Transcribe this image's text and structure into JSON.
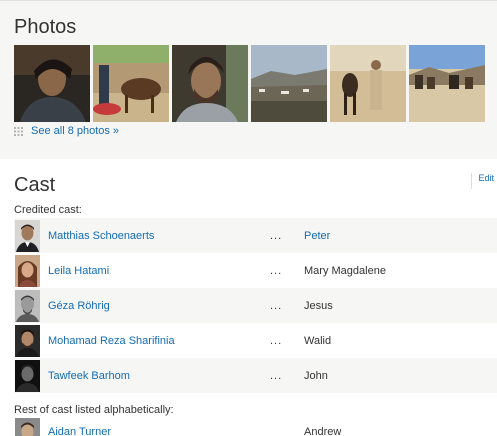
{
  "photos": {
    "title": "Photos",
    "see_all_label": "See all 8 photos",
    "see_all_arrow": "»",
    "thumbnails": [
      {
        "name": "photo-thumbnail-1",
        "palette": [
          "#3a2a1d",
          "#7d5c40",
          "#1c1a18"
        ]
      },
      {
        "name": "photo-thumbnail-2",
        "palette": [
          "#b9a27e",
          "#6a4a2b",
          "#c03a3a"
        ]
      },
      {
        "name": "photo-thumbnail-3",
        "palette": [
          "#5c4a3a",
          "#8a6d52",
          "#2a2420"
        ]
      },
      {
        "name": "photo-thumbnail-4",
        "palette": [
          "#9fb0c4",
          "#6e6a5a",
          "#3f3d36"
        ]
      },
      {
        "name": "photo-thumbnail-5",
        "palette": [
          "#cbb38c",
          "#4a3a2c",
          "#e6dcc6"
        ]
      },
      {
        "name": "photo-thumbnail-6",
        "palette": [
          "#7ea6d6",
          "#6b5a4a",
          "#d8c8a8"
        ]
      }
    ]
  },
  "cast": {
    "title": "Cast",
    "edit_label": "Edit",
    "credited_label": "Credited cast:",
    "separator": "...",
    "credited": [
      {
        "actor": "Matthias Schoenaerts",
        "character": "Peter",
        "character_linked": true
      },
      {
        "actor": "Leila Hatami",
        "character": "Mary Magdalene",
        "character_linked": false
      },
      {
        "actor": "Géza Röhrig",
        "character": "Jesus",
        "character_linked": false
      },
      {
        "actor": "Mohamad Reza Sharifinia",
        "character": "Walid",
        "character_linked": false
      },
      {
        "actor": "Tawfeek Barhom",
        "character": "John",
        "character_linked": false
      }
    ],
    "rest_label": "Rest of cast listed alphabetically:",
    "rest": [
      {
        "actor": "Aidan Turner",
        "character": "Andrew",
        "character_linked": false
      }
    ]
  }
}
